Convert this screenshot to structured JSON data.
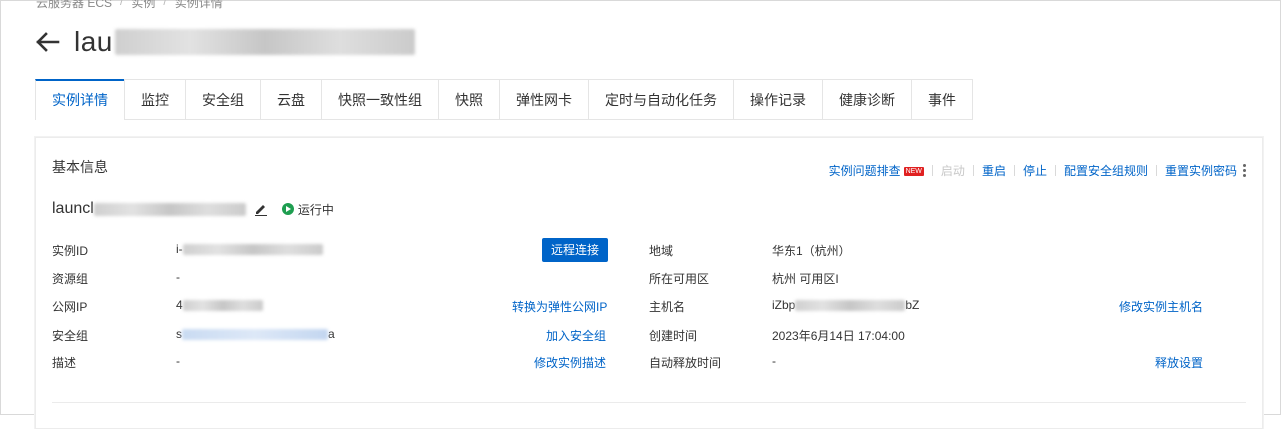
{
  "breadcrumb": [
    "云服务器 ECS",
    "实例",
    "实例详情"
  ],
  "title": "lau",
  "tabs": [
    "实例详情",
    "监控",
    "安全组",
    "云盘",
    "快照一致性组",
    "快照",
    "弹性网卡",
    "定时与自动化任务",
    "操作记录",
    "健康诊断",
    "事件"
  ],
  "active_tab": "实例详情",
  "section_title": "基本信息",
  "actions": {
    "troubleshoot": "实例问题排查",
    "new_badge": "NEW",
    "start": "启动",
    "restart": "重启",
    "stop": "停止",
    "config_sg": "配置安全组规则",
    "reset_pwd": "重置实例密码"
  },
  "instance": {
    "name_prefix": "launcl",
    "status": "运行中"
  },
  "left_fields": {
    "instance_id_label": "实例ID",
    "instance_id_prefix": "i-",
    "resource_group_label": "资源组",
    "resource_group_value": "-",
    "public_ip_label": "公网IP",
    "public_ip_prefix": "4",
    "security_group_label": "安全组",
    "security_group_prefix": "s",
    "security_group_suffix": "a",
    "description_label": "描述",
    "description_value": "-"
  },
  "left_actions": {
    "remote_connect": "远程连接",
    "convert_eip": "转换为弹性公网IP",
    "join_sg": "加入安全组",
    "edit_desc": "修改实例描述"
  },
  "right_fields": {
    "region_label": "地域",
    "region_value": "华东1（杭州）",
    "zone_label": "所在可用区",
    "zone_value": "杭州 可用区I",
    "hostname_label": "主机名",
    "hostname_prefix": "iZbp",
    "hostname_suffix": "bZ",
    "created_label": "创建时间",
    "created_value": "2023年6月14日 17:04:00",
    "release_label": "自动释放时间",
    "release_value": "-"
  },
  "right_actions": {
    "edit_hostname": "修改实例主机名",
    "release_settings": "释放设置"
  }
}
